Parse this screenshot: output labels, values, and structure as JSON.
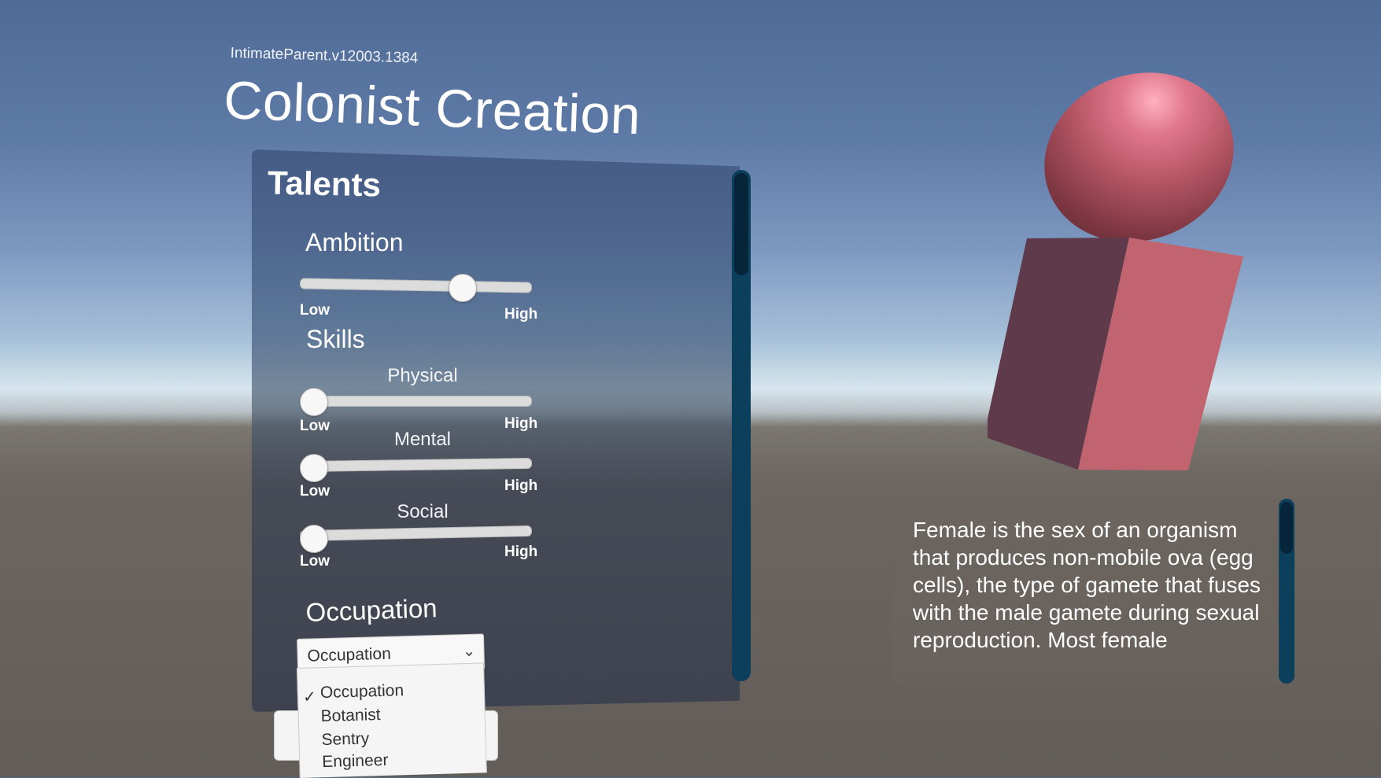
{
  "header": {
    "version": "IntimateParent.v12003.1384",
    "title": "Colonist Creation"
  },
  "panel": {
    "title": "Talents",
    "ambition": {
      "label": "Ambition",
      "low": "Low",
      "high": "High",
      "value": 0.73
    },
    "skills": {
      "label": "Skills",
      "physical": {
        "label": "Physical",
        "low": "Low",
        "high": "High",
        "value": 0.0
      },
      "mental": {
        "label": "Mental",
        "low": "Low",
        "high": "High",
        "value": 0.0
      },
      "social": {
        "label": "Social",
        "low": "Low",
        "high": "High",
        "value": 0.0
      }
    },
    "occupation": {
      "label": "Occupation",
      "selected": "Occupation",
      "options": [
        "Occupation",
        "Botanist",
        "Sentry",
        "Engineer"
      ]
    }
  },
  "info": {
    "text": "Female is the sex of an organism that produces non-mobile ova (egg cells), the type of gamete that fuses with the male gamete during sexual reproduction. Most female"
  },
  "colors": {
    "scrollbar": "#0c3f5c",
    "object": "#c86a78"
  }
}
